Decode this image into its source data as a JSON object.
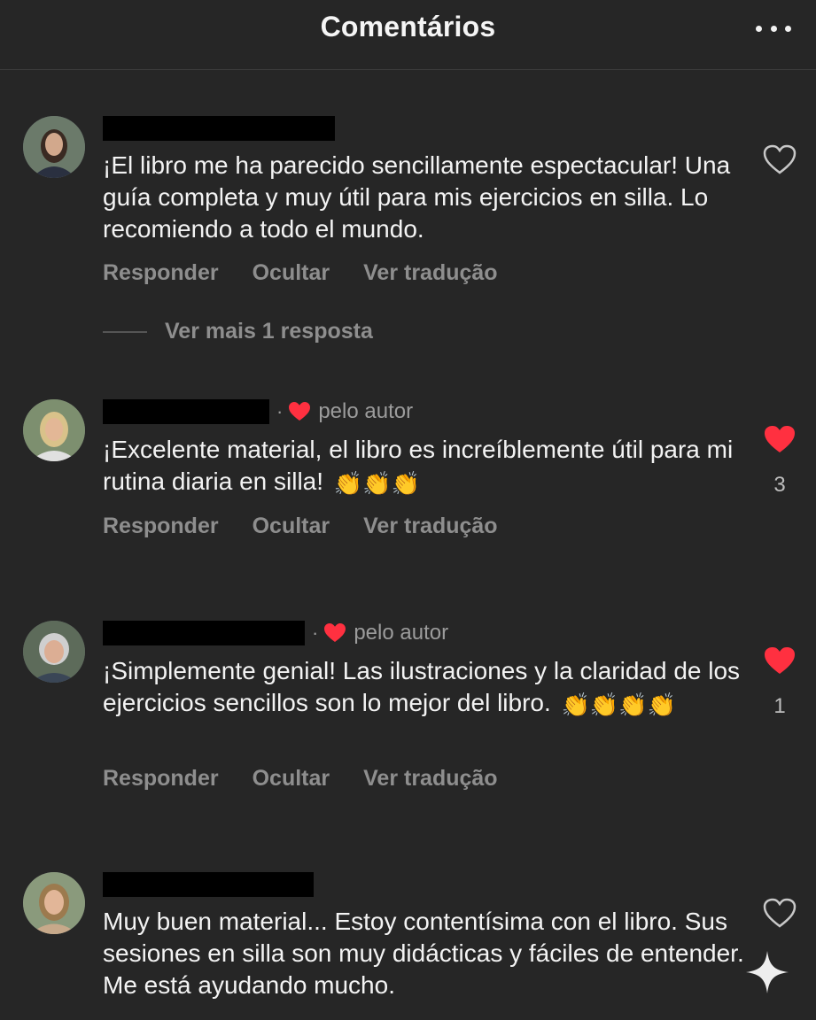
{
  "header": {
    "title": "Comentários",
    "more_icon": "more-horizontal-icon"
  },
  "actions": {
    "reply": "Responder",
    "hide": "Ocultar",
    "translate": "Ver tradução"
  },
  "colors": {
    "background": "#262626",
    "like_red": "#ff3040",
    "muted_text": "#8e8e8e"
  },
  "comments": [
    {
      "text": "¡El libro me ha parecido sencillamente espectacular! Una guía completa y muy útil para mis ejercicios en silla. Lo recomiendo a todo el mundo.",
      "liked": false,
      "like_count": "",
      "author_liked": false,
      "view_more": "Ver mais 1 resposta"
    },
    {
      "text": "¡Excelente material, el libro es increíblemente útil para mi rutina diaria en silla!",
      "emoji": "👏👏👏",
      "liked": true,
      "like_count": "3",
      "author_liked": true,
      "author_label": "pelo autor"
    },
    {
      "text": "¡Simplemente genial! Las ilustraciones y la claridad de los ejercicios sencillos son lo mejor del libro.",
      "emoji": "👏👏👏👏",
      "liked": true,
      "like_count": "1",
      "author_liked": true,
      "author_label": "pelo autor"
    },
    {
      "text": "Muy buen material... Estoy contentísima con el libro. Sus sesiones en silla son muy didácticas y fáciles de entender. Me está ayudando mucho.",
      "liked": false,
      "like_count": "",
      "author_liked": false
    }
  ]
}
